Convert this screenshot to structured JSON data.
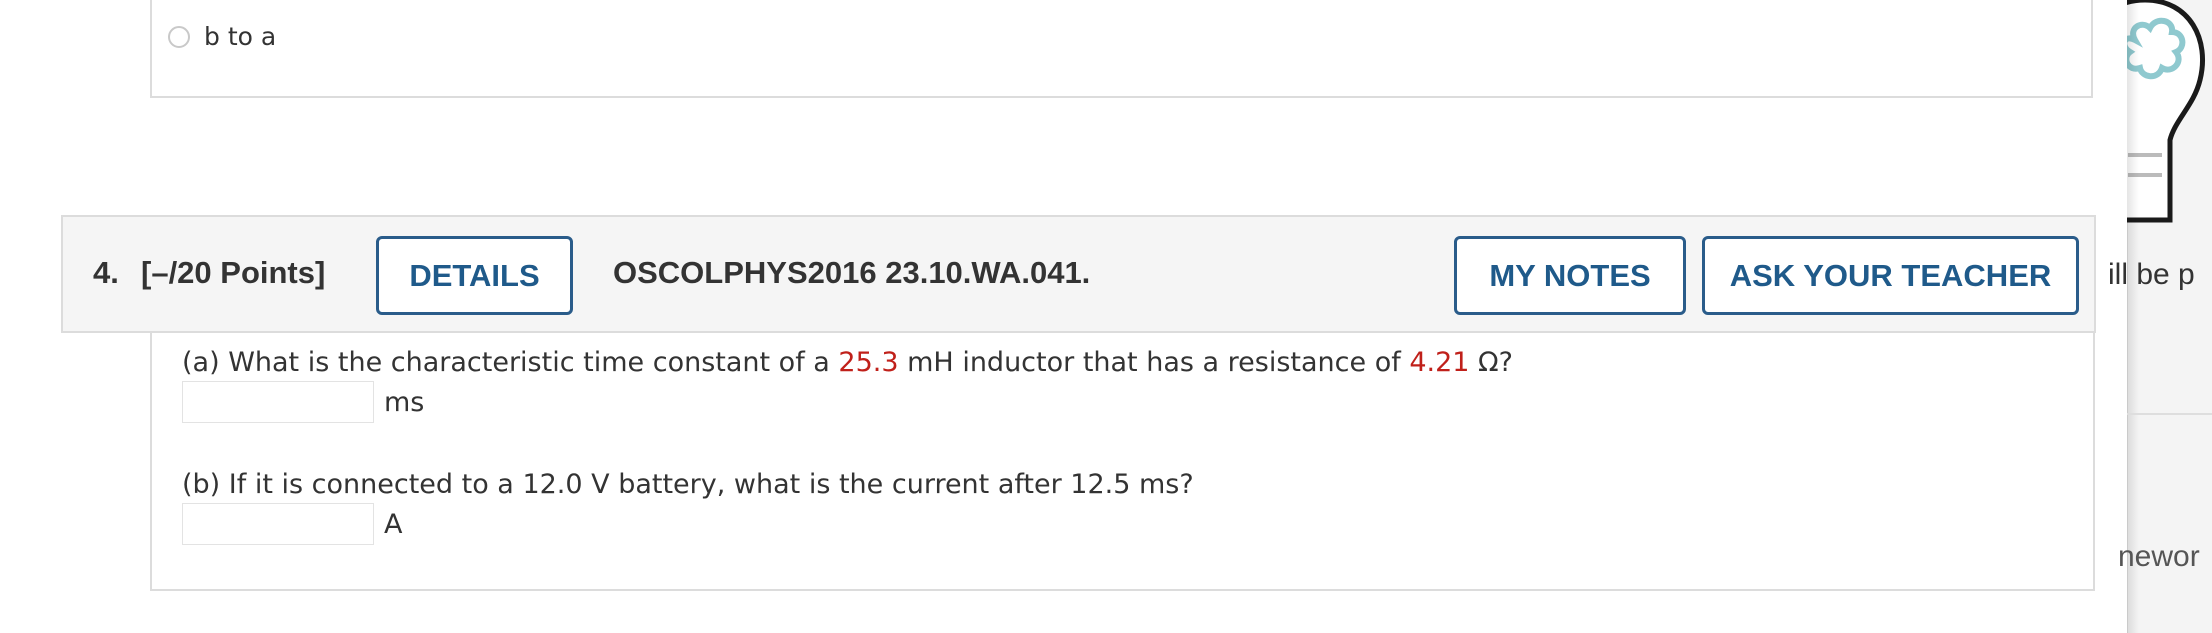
{
  "previous_question": {
    "option_label": "b to a"
  },
  "question": {
    "number": "4.",
    "points": "[–/20 Points]",
    "details_label": "DETAILS",
    "code": "OSCOLPHYS2016 23.10.WA.041.",
    "my_notes_label": "MY NOTES",
    "ask_teacher_label": "ASK YOUR TEACHER",
    "part_a": {
      "text_before_inductance": "(a) What is the characteristic time constant of a ",
      "inductance": "25.3",
      "text_middle": " mH inductor that has a resistance of ",
      "resistance": "4.21",
      "text_after": " Ω?",
      "answer_value": "",
      "unit": "ms"
    },
    "part_b": {
      "text": "(b) If it is connected to a 12.0 V battery, what is the current after 12.5 ms?",
      "answer_value": "",
      "unit": "A"
    }
  },
  "side_panel": {
    "text_1": "ill be p",
    "text_2": "newor",
    "icon": "lightbulb-brain-icon"
  },
  "colors": {
    "accent": "#2a5c8a",
    "highlight_red": "#c0201a",
    "header_bg": "#f5f5f5",
    "border": "#dcdcdc",
    "icon_teal": "#8fc9cf"
  }
}
